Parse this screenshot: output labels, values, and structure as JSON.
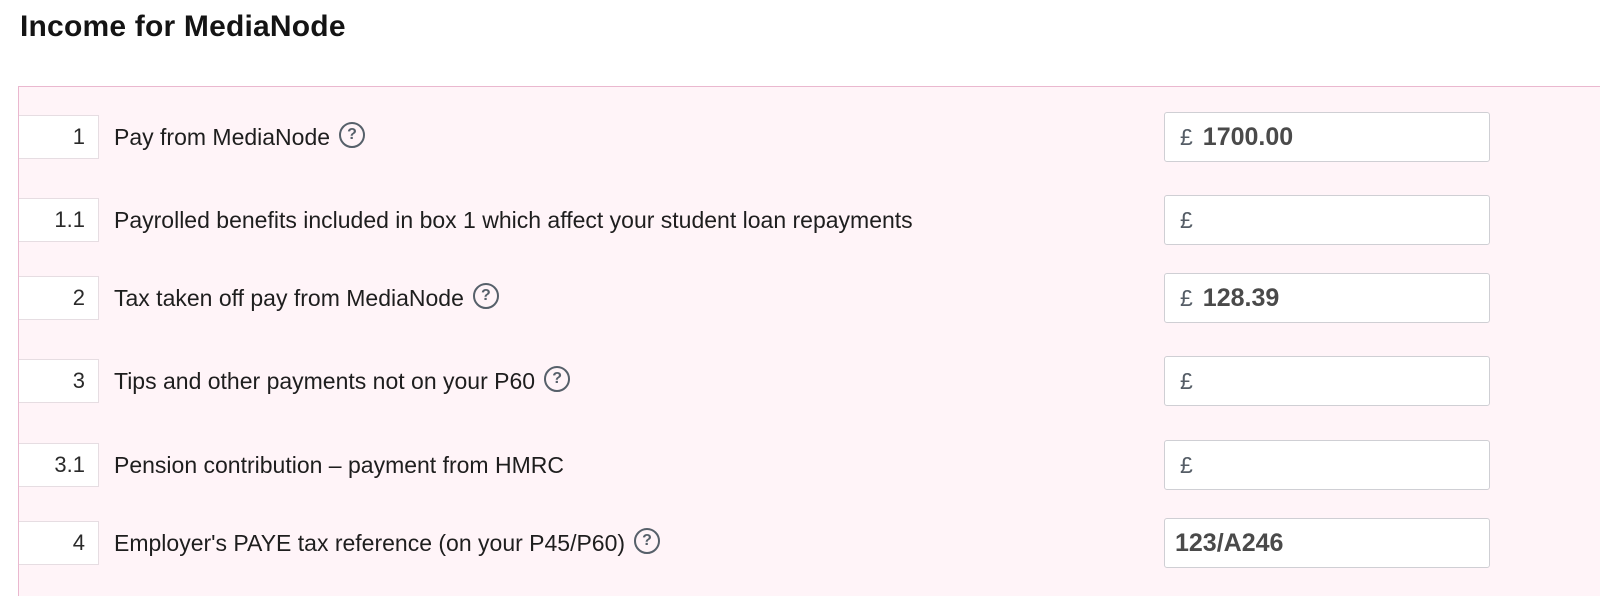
{
  "page": {
    "title": "Income for MediaNode"
  },
  "colors": {
    "panel_background": "#fff4f8",
    "panel_border": "#eab8cf",
    "help_icon": "#56606a"
  },
  "rows": [
    {
      "box": "1",
      "label": "Pay from MediaNode",
      "has_help": true,
      "currency": "£",
      "value": "1700.00"
    },
    {
      "box": "1.1",
      "label": "Payrolled benefits included in box 1 which affect your student loan repayments",
      "has_help": false,
      "currency": "£",
      "value": ""
    },
    {
      "box": "2",
      "label": "Tax taken off pay from MediaNode",
      "has_help": true,
      "currency": "£",
      "value": "128.39"
    },
    {
      "box": "3",
      "label": "Tips and other payments not on your P60",
      "has_help": true,
      "currency": "£",
      "value": ""
    },
    {
      "box": "3.1",
      "label": "Pension contribution – payment from HMRC",
      "has_help": false,
      "currency": "£",
      "value": ""
    },
    {
      "box": "4",
      "label": "Employer's PAYE tax reference (on your P45/P60)",
      "has_help": true,
      "currency": "",
      "value": "123/A246"
    }
  ],
  "icons": {
    "help": "help-circle-icon",
    "help_glyph": "?"
  }
}
